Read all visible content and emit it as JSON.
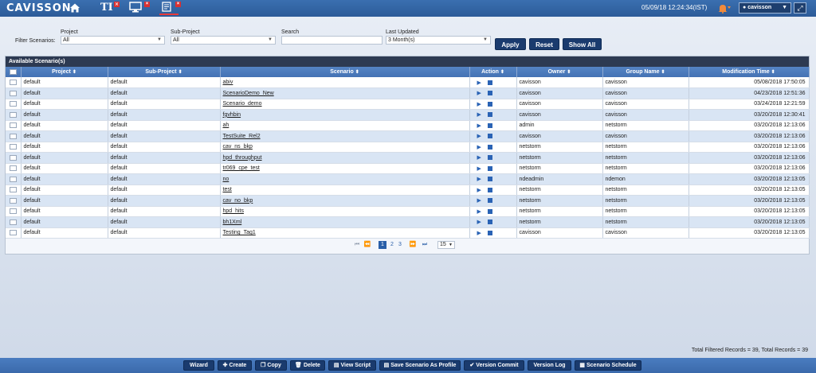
{
  "header": {
    "logo": "CAVISSON",
    "datetime": "05/09/18 12:24:34(IST)",
    "user": "cavisson",
    "tab_ti_label": "TI"
  },
  "filters": {
    "prefix_label": "Filter Scenarios:",
    "project_label": "Project",
    "project_value": "All",
    "subproject_label": "Sub-Project",
    "subproject_value": "All",
    "search_label": "Search",
    "search_value": "",
    "last_updated_label": "Last Updated",
    "last_updated_value": "3 Month(s)",
    "apply": "Apply",
    "reset": "Reset",
    "show_all": "Show All"
  },
  "table": {
    "title": "Available Scenario(s)",
    "columns": [
      "Project",
      "Sub-Project",
      "Scenario",
      "Action",
      "Owner",
      "Group Name",
      "Modification Time"
    ],
    "rows": [
      {
        "project": "default",
        "subproject": "default",
        "scenario": "abiv",
        "owner": "cavisson",
        "group": "cavisson",
        "time": "05/08/2018 17:50:05"
      },
      {
        "project": "default",
        "subproject": "default",
        "scenario": "ScenarioDemo_New",
        "owner": "cavisson",
        "group": "cavisson",
        "time": "04/23/2018 12:51:36"
      },
      {
        "project": "default",
        "subproject": "default",
        "scenario": "Scenario_demo",
        "owner": "cavisson",
        "group": "cavisson",
        "time": "03/24/2018 12:21:59"
      },
      {
        "project": "default",
        "subproject": "default",
        "scenario": "fgvhbin",
        "owner": "cavisson",
        "group": "cavisson",
        "time": "03/20/2018 12:30:41"
      },
      {
        "project": "default",
        "subproject": "default",
        "scenario": "ah",
        "owner": "admin",
        "group": "netstorm",
        "time": "03/20/2018 12:13:06"
      },
      {
        "project": "default",
        "subproject": "default",
        "scenario": "TestSuite_Rel2",
        "owner": "cavisson",
        "group": "cavisson",
        "time": "03/20/2018 12:13:06"
      },
      {
        "project": "default",
        "subproject": "default",
        "scenario": "cav_ns_bkp",
        "owner": "netstorm",
        "group": "netstorm",
        "time": "03/20/2018 12:13:06"
      },
      {
        "project": "default",
        "subproject": "default",
        "scenario": "hpd_throughput",
        "owner": "netstorm",
        "group": "netstorm",
        "time": "03/20/2018 12:13:06"
      },
      {
        "project": "default",
        "subproject": "default",
        "scenario": "tr069_cpe_test",
        "owner": "netstorm",
        "group": "netstorm",
        "time": "03/20/2018 12:13:06"
      },
      {
        "project": "default",
        "subproject": "default",
        "scenario": "no",
        "owner": "ndeadmin",
        "group": "ndemon",
        "time": "03/20/2018 12:13:05"
      },
      {
        "project": "default",
        "subproject": "default",
        "scenario": "test",
        "owner": "netstorm",
        "group": "netstorm",
        "time": "03/20/2018 12:13:05"
      },
      {
        "project": "default",
        "subproject": "default",
        "scenario": "cav_no_bkp",
        "owner": "netstorm",
        "group": "netstorm",
        "time": "03/20/2018 12:13:05"
      },
      {
        "project": "default",
        "subproject": "default",
        "scenario": "hpd_hits",
        "owner": "netstorm",
        "group": "netstorm",
        "time": "03/20/2018 12:13:05"
      },
      {
        "project": "default",
        "subproject": "default",
        "scenario": "bh1Xml",
        "owner": "netstorm",
        "group": "netstorm",
        "time": "03/20/2018 12:13:05"
      },
      {
        "project": "default",
        "subproject": "default",
        "scenario": "Testing_Tag1",
        "owner": "cavisson",
        "group": "cavisson",
        "time": "03/20/2018 12:13:05"
      }
    ]
  },
  "pagination": {
    "pages": [
      "1",
      "2",
      "3"
    ],
    "current": "1",
    "per_page": "15"
  },
  "footer": {
    "records": "Total Filtered Records = 39, Total Records = 39",
    "buttons": [
      "Wizard",
      "Create",
      "Copy",
      "Delete",
      "View Script",
      "Save Scenario As Profile",
      "Version Commit",
      "Version Log",
      "Scenario Schedule"
    ]
  },
  "colors": {
    "topbar": "#2c5b98",
    "button": "#1a3b6e",
    "row_alt": "#d9e5f4",
    "header": "#4472b4"
  }
}
